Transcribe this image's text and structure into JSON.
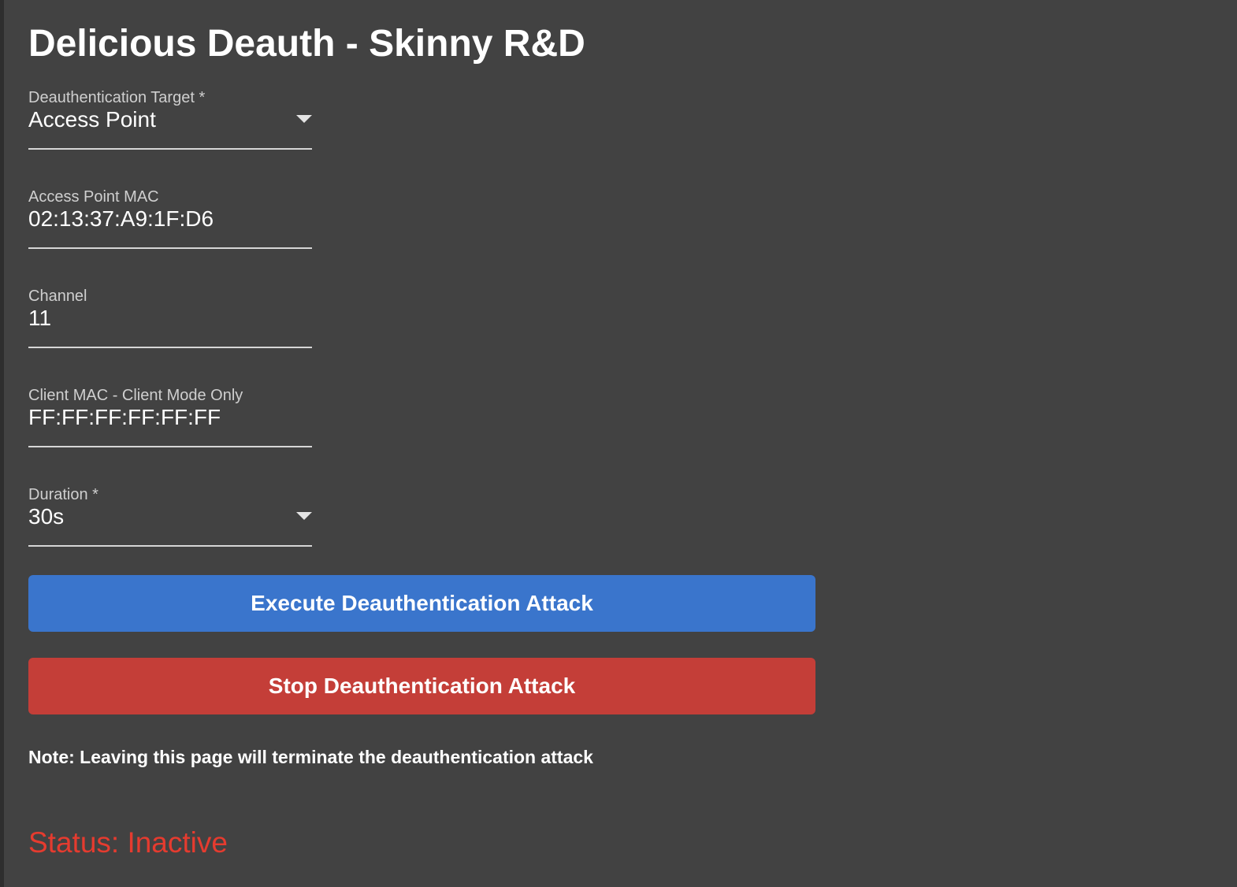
{
  "page_title": "Delicious Deauth - Skinny R&D",
  "form": {
    "target": {
      "label": "Deauthentication Target *",
      "value": "Access Point",
      "icon": "chevron-down-icon"
    },
    "ap_mac": {
      "label": "Access Point MAC",
      "value": "02:13:37:A9:1F:D6"
    },
    "channel": {
      "label": "Channel",
      "value": "11"
    },
    "client_mac": {
      "label": "Client MAC - Client Mode Only",
      "value": "FF:FF:FF:FF:FF:FF"
    },
    "duration": {
      "label": "Duration *",
      "value": "30s",
      "icon": "chevron-down-icon"
    }
  },
  "actions": {
    "execute_label": "Execute Deauthentication Attack",
    "execute_color": "#3a75cc",
    "stop_label": "Stop Deauthentication Attack",
    "stop_color": "#c43e38"
  },
  "note": "Note: Leaving this page will terminate the deauthentication attack",
  "status": {
    "text": "Status: Inactive",
    "color": "#e53b2f"
  },
  "colors": {
    "background": "#424242",
    "text": "#ffffff"
  }
}
